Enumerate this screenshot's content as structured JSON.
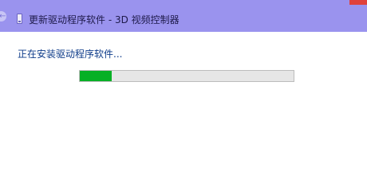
{
  "window": {
    "title": "更新驱动程序软件 - 3D 视频控制器",
    "icons": {
      "back": "back-arrow-icon",
      "device": "device-icon",
      "close": "close-icon"
    },
    "colors": {
      "titlebar": "#9a93ee",
      "close": "#e0413b"
    }
  },
  "main": {
    "status_text": "正在安装驱动程序软件...",
    "progress": {
      "fraction": 0.15,
      "fill_color": "#06b025",
      "track_color": "#e6e6e6"
    }
  }
}
